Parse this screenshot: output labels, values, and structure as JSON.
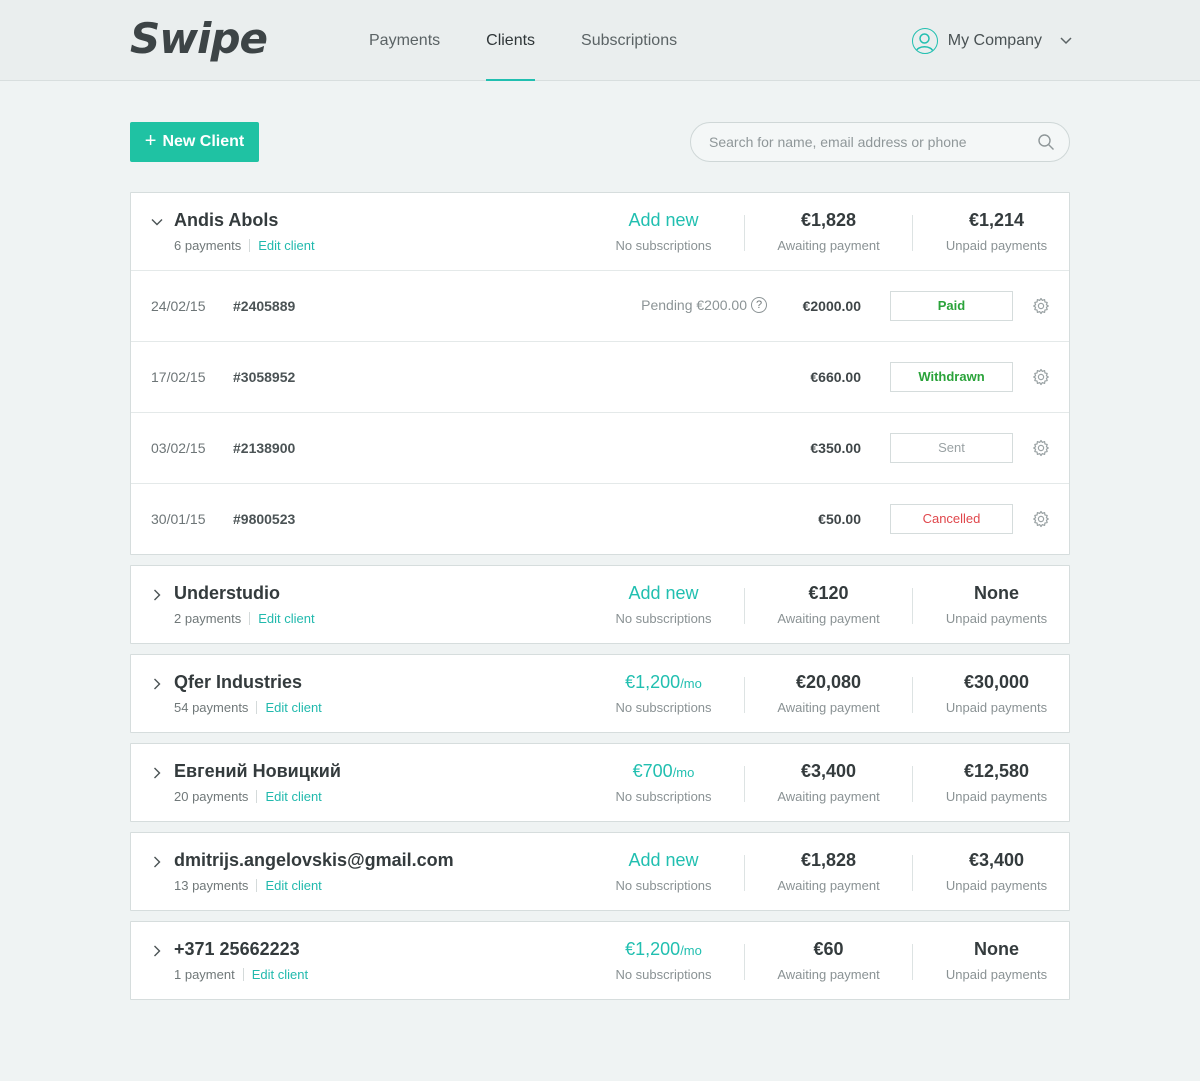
{
  "header": {
    "logo": "Swipe",
    "nav": [
      {
        "label": "Payments",
        "active": false
      },
      {
        "label": "Clients",
        "active": true
      },
      {
        "label": "Subscriptions",
        "active": false
      }
    ],
    "account_label": "My Company"
  },
  "toolbar": {
    "new_client_label": "New Client",
    "search_placeholder": "Search for name, email address or phone"
  },
  "colors": {
    "accent": "#21bfb0",
    "button": "#1fc2a3",
    "paid": "#2aa33a",
    "cancelled": "#e0474c"
  },
  "clients": [
    {
      "name": "Andis Abols",
      "payments": "6 payments",
      "edit_label": "Edit client",
      "subscription": "Add new",
      "subscription_unit": "",
      "subscription_sub": "No subscriptions",
      "awaiting": "€1,828",
      "awaiting_label": "Awaiting payment",
      "unpaid": "€1,214",
      "unpaid_label": "Unpaid payments",
      "expanded": true,
      "rows": [
        {
          "date": "24/02/15",
          "id": "#2405889",
          "pending": "Pending €200.00",
          "amount": "€2000.00",
          "status": "Paid"
        },
        {
          "date": "17/02/15",
          "id": "#3058952",
          "pending": "",
          "amount": "€660.00",
          "status": "Withdrawn"
        },
        {
          "date": "03/02/15",
          "id": "#2138900",
          "pending": "",
          "amount": "€350.00",
          "status": "Sent"
        },
        {
          "date": "30/01/15",
          "id": "#9800523",
          "pending": "",
          "amount": "€50.00",
          "status": "Cancelled"
        }
      ]
    },
    {
      "name": "Understudio",
      "payments": "2 payments",
      "edit_label": "Edit client",
      "subscription": "Add new",
      "subscription_unit": "",
      "subscription_sub": "No subscriptions",
      "awaiting": "€120",
      "awaiting_label": "Awaiting payment",
      "unpaid": "None",
      "unpaid_label": "Unpaid payments",
      "expanded": false,
      "rows": []
    },
    {
      "name": "Qfer Industries",
      "payments": "54 payments",
      "edit_label": "Edit client",
      "subscription": "€1,200",
      "subscription_unit": "/mo",
      "subscription_sub": "No subscriptions",
      "awaiting": "€20,080",
      "awaiting_label": "Awaiting payment",
      "unpaid": "€30,000",
      "unpaid_label": "Unpaid payments",
      "expanded": false,
      "rows": []
    },
    {
      "name": "Евгений Новицкий",
      "payments": "20 payments",
      "edit_label": "Edit client",
      "subscription": "€700",
      "subscription_unit": "/mo",
      "subscription_sub": "No subscriptions",
      "awaiting": "€3,400",
      "awaiting_label": "Awaiting payment",
      "unpaid": "€12,580",
      "unpaid_label": "Unpaid payments",
      "expanded": false,
      "rows": []
    },
    {
      "name": "dmitrijs.angelovskis@gmail.com",
      "payments": "13 payments",
      "edit_label": "Edit client",
      "subscription": "Add new",
      "subscription_unit": "",
      "subscription_sub": "No subscriptions",
      "awaiting": "€1,828",
      "awaiting_label": "Awaiting payment",
      "unpaid": "€3,400",
      "unpaid_label": "Unpaid payments",
      "expanded": false,
      "rows": []
    },
    {
      "name": "+371 25662223",
      "payments": "1 payment",
      "edit_label": "Edit client",
      "subscription": "€1,200",
      "subscription_unit": "/mo",
      "subscription_sub": "No subscriptions",
      "awaiting": "€60",
      "awaiting_label": "Awaiting payment",
      "unpaid": "None",
      "unpaid_label": "Unpaid payments",
      "expanded": false,
      "rows": []
    }
  ]
}
